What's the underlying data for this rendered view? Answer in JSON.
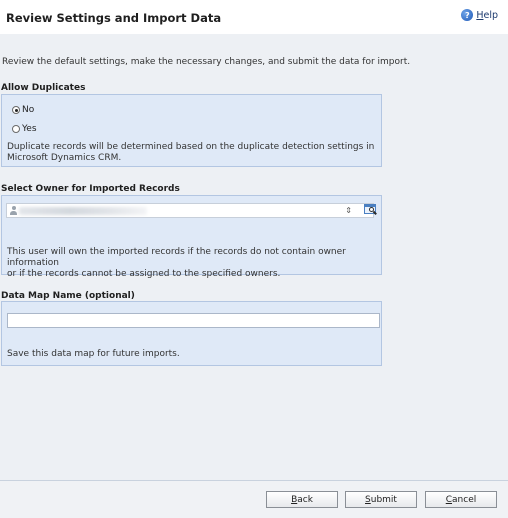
{
  "header": {
    "title": "Review Settings and Import Data",
    "help": {
      "hotkey": "H",
      "rest": "elp",
      "icon": "help-icon"
    }
  },
  "intro": "Review the default settings, make the necessary changes, and submit the data for import.",
  "allow_duplicates": {
    "title": "Allow Duplicates",
    "options": [
      {
        "label": "No",
        "selected": true
      },
      {
        "label": "Yes",
        "selected": false
      }
    ],
    "note_line1": "Duplicate records will be determined based on the duplicate detection settings in",
    "note_line2": "Microsoft Dynamics CRM."
  },
  "owner": {
    "title": "Select Owner for Imported Records",
    "scroll_glyph": "⇕",
    "note_line1": "This user will own the imported records if the records do not contain owner information",
    "note_line2": "or if the records cannot be assigned to the specified owners."
  },
  "data_map": {
    "title": "Data Map Name (optional)",
    "value": "",
    "note": "Save this data map for future imports."
  },
  "footer": {
    "back": {
      "hotkey": "B",
      "rest": "ack"
    },
    "submit": {
      "hotkey": "S",
      "rest": "ubmit"
    },
    "cancel": {
      "hotkey": "C",
      "rest": "ancel"
    }
  },
  "colors": {
    "section_fill": "#dfe9f7",
    "section_border": "#b3c6e2",
    "page_background": "#edf0f4"
  }
}
